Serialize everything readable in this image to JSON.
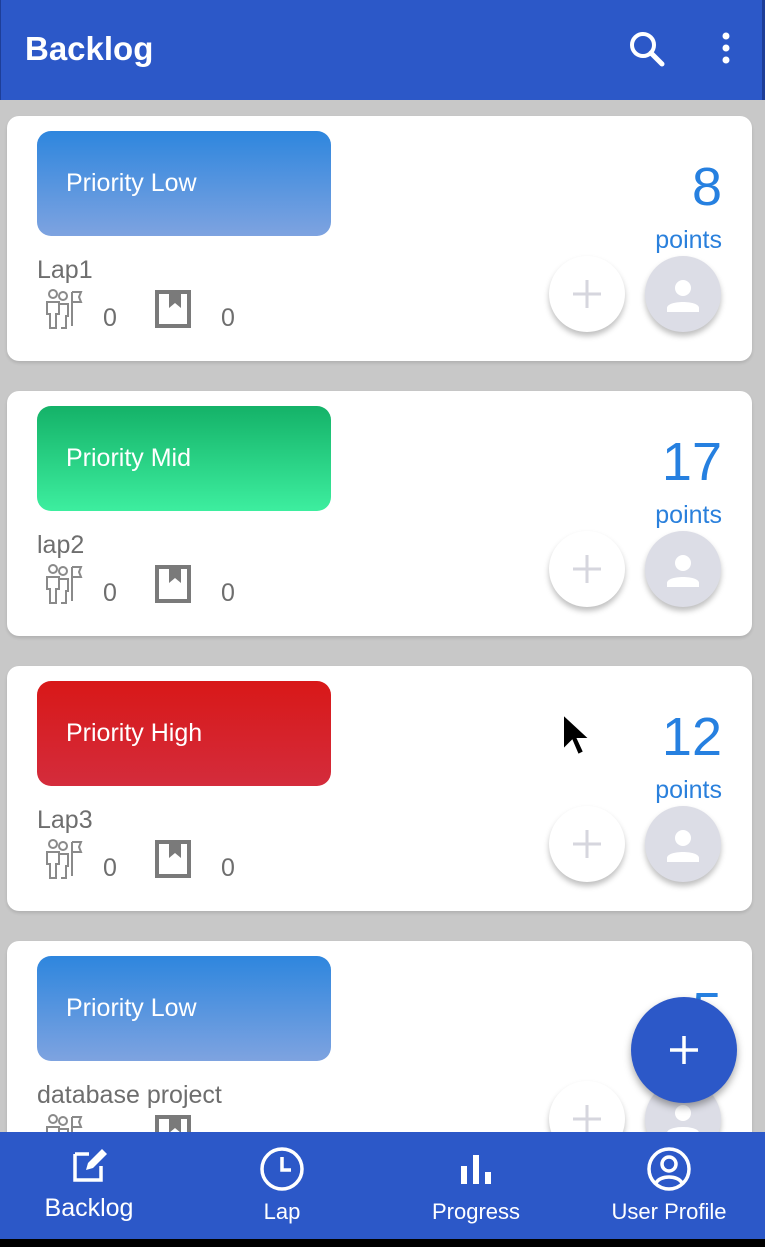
{
  "app_bar": {
    "title": "Backlog",
    "icons": [
      "search-icon",
      "more-vert-icon"
    ],
    "color": "#2c58c8"
  },
  "cards": [
    {
      "priority": "Priority Low",
      "priority_color": "#2e86de",
      "name": "Lap1",
      "points": "8",
      "points_label": "points",
      "stat1": "0",
      "stat2": "0"
    },
    {
      "priority": "Priority Mid",
      "priority_color": "#14b268",
      "name": "lap2",
      "points": "17",
      "points_label": "points",
      "stat1": "0",
      "stat2": "0"
    },
    {
      "priority": "Priority High",
      "priority_color": "#d81818",
      "name": "Lap3",
      "points": "12",
      "points_label": "points",
      "stat1": "0",
      "stat2": "0"
    },
    {
      "priority": "Priority Low",
      "priority_color": "#2e86de",
      "name": "database project",
      "points": "5",
      "points_label": "",
      "stat1": "",
      "stat2": ""
    }
  ],
  "fab": {
    "icon": "add-icon"
  },
  "bottom_nav": [
    {
      "label": "Backlog",
      "icon": "edit-icon"
    },
    {
      "label": "Lap",
      "icon": "clock-icon"
    },
    {
      "label": "Progress",
      "icon": "bar-chart-icon"
    },
    {
      "label": "User Profile",
      "icon": "account-circle-icon"
    }
  ]
}
